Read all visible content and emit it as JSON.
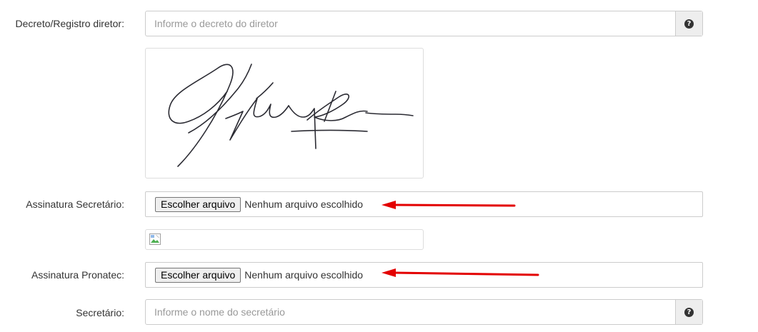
{
  "fields": {
    "decreto": {
      "label": "Decreto/Registro diretor:",
      "placeholder": "Informe o decreto do diretor",
      "help_icon": "?"
    },
    "assinatura_secretario": {
      "label": "Assinatura Secretário:",
      "button_label": "Escolher arquivo",
      "status": "Nenhum arquivo escolhido"
    },
    "assinatura_pronatec": {
      "label": "Assinatura Pronatec:",
      "button_label": "Escolher arquivo",
      "status": "Nenhum arquivo escolhido"
    },
    "secretario": {
      "label": "Secretário:",
      "placeholder": "Informe o nome do secretário",
      "help_icon": "?"
    }
  },
  "icons": {
    "help": "question-circle-icon",
    "broken_image": "broken-image-icon",
    "arrow": "red-arrow-icon"
  },
  "colors": {
    "arrow": "#e30000",
    "signature_ink": "#2b2b33"
  }
}
